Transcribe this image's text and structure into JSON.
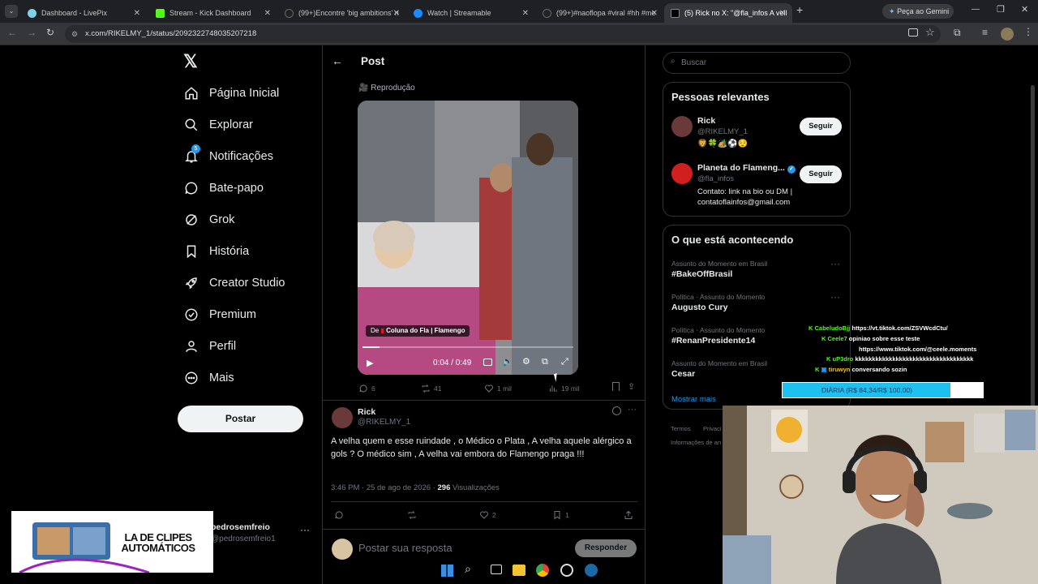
{
  "browser": {
    "tabs": [
      {
        "title": "Dashboard - LivePix",
        "color": "#7fd1e8"
      },
      {
        "title": "Stream - Kick Dashboard",
        "color": "#53fc18"
      },
      {
        "title": "(99+)Encontre 'big ambitions' n",
        "color": "#000000"
      },
      {
        "title": "Watch | Streamable",
        "color": "#1a8cff"
      },
      {
        "title": "(99+)#naoflopa #viral #hh #me",
        "color": "#000000"
      },
      {
        "title": "(5) Rick no X: \"@fla_infos A vell",
        "color": "#000000"
      }
    ],
    "new_tab": "+",
    "gemini": "Peça ao Gemini",
    "url": "x.com/RIKELMY_1/status/2092322748035207218"
  },
  "nav": {
    "logo": "𝕏",
    "items": [
      {
        "label": "Página Inicial",
        "icon": "home-icon"
      },
      {
        "label": "Explorar",
        "icon": "search-icon"
      },
      {
        "label": "Notificações",
        "icon": "bell-icon",
        "badge": "5"
      },
      {
        "label": "Bate-papo",
        "icon": "chat-icon"
      },
      {
        "label": "Grok",
        "icon": "grok-icon"
      },
      {
        "label": "História",
        "icon": "bookmark-icon"
      },
      {
        "label": "Creator Studio",
        "icon": "rocket-icon"
      },
      {
        "label": "Premium",
        "icon": "verified-icon"
      },
      {
        "label": "Perfil",
        "icon": "person-icon"
      },
      {
        "label": "Mais",
        "icon": "more-circle-icon"
      }
    ],
    "post_button": "Postar",
    "account_name": "pedrosemfreio",
    "account_handle": "@pedrosemfreio1"
  },
  "header": {
    "title": "Post"
  },
  "quoted": {
    "replay_label": "🎥 Reprodução",
    "video_source_prefix": "De",
    "video_source": "Coluna do Fla | Flamengo",
    "time": "0:04 / 0:49",
    "progress": 0.08,
    "actions": {
      "replies": "6",
      "reposts": "41",
      "likes": "1 mil",
      "views": "19 mil"
    }
  },
  "post": {
    "author": "Rick",
    "handle": "@RIKELMY_1",
    "text": "A velha quem e esse ruindade , o Médico o Plata , A velha aquele alérgico a gols ? O médico sim , A velha vai embora do Flamengo praga !!!",
    "timestamp": "3:46 PM · 25 de ago de 2026 ·",
    "views_count": "296",
    "views_label": "Visualizações",
    "likes": "2",
    "bookmarks": "1",
    "reply_placeholder": "Postar sua resposta",
    "reply_button": "Responder"
  },
  "sidebar": {
    "search_placeholder": "Buscar",
    "relevant_title": "Pessoas relevantes",
    "people": [
      {
        "name": "Rick",
        "handle": "@RIKELMY_1",
        "bio": "🦁🍀🏕️⚽😌",
        "follow": "Seguir"
      },
      {
        "name": "Planeta do Flameng...",
        "handle": "@fla_infos",
        "bio": "Contato: link na bio ou DM | contatoflainfos@gmail.com",
        "follow": "Seguir"
      }
    ],
    "trends_title": "O que está acontecendo",
    "trends": [
      {
        "meta": "Assunto do Momento em Brasil",
        "title": "#BakeOffBrasil"
      },
      {
        "meta": "Política · Assunto do Momento",
        "title": "Augusto Cury"
      },
      {
        "meta": "Política · Assunto do Momento",
        "title": "#RenanPresidente14"
      },
      {
        "meta": "Assunto do Momento em Brasil",
        "title": "Cesar"
      }
    ],
    "show_more": "Mostrar mais",
    "footer_1": "Termos",
    "footer_2": "Privaci",
    "footer_3": "Informações de an"
  },
  "overlay": {
    "chat": [
      {
        "user": "CabeludoBjj",
        "msg": "https://vt.tiktok.com/ZSVWcdCtu/",
        "color": "#53fc18"
      },
      {
        "user": "Ceele7",
        "msg": "opiniao sobre esse teste",
        "color": "#53fc18"
      },
      {
        "user": "",
        "msg": "https://www.tiktok.com/@ceele.moments",
        "color": "#ffffff"
      },
      {
        "user": "uP3dro",
        "msg": "kkkkkkkkkkkkkkkkkkkkkkkkkkkkkkkkkkk",
        "color": "#53fc18"
      },
      {
        "user": "tiruwyn",
        "msg": "conversando sozin",
        "color": "#f4c430"
      }
    ],
    "goal_label": "DIÁRIA (R$ 84,34/R$ 100,00)",
    "goal_fraction": 0.84,
    "promo_text": "LA DE CLIPES AUTOMÁTICOS"
  }
}
